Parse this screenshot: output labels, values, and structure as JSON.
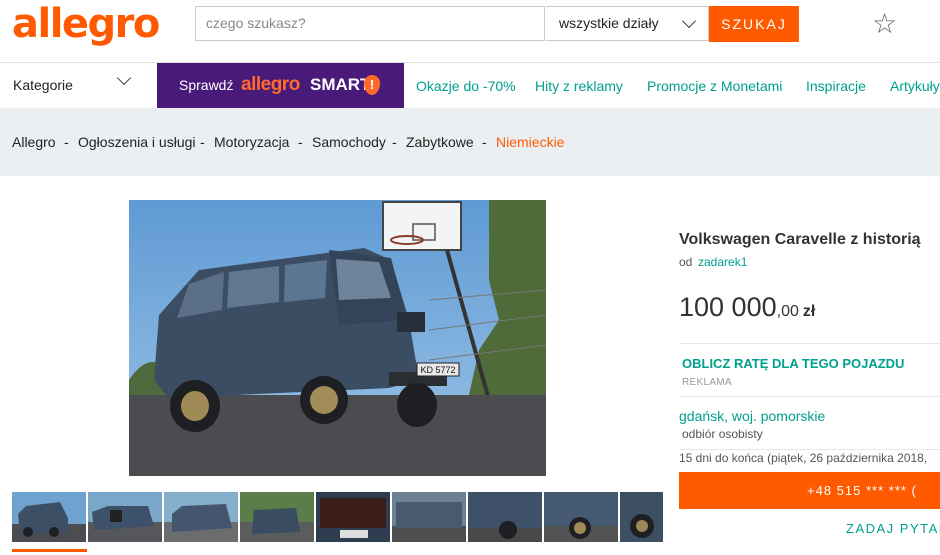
{
  "header": {
    "logo": "allegro",
    "search_placeholder": "czego szukasz?",
    "department": "wszystkie działy",
    "search_button": "SZUKAJ"
  },
  "nav": {
    "categories": "Kategorie",
    "smart_prefix": "Sprawdź",
    "smart_brand": "allegro",
    "smart_word": "SMART",
    "smart_badge": "!",
    "links": [
      "Okazje do -70%",
      "Hity z reklamy",
      "Promocje z Monetami",
      "Inspiracje",
      "Artykuły"
    ]
  },
  "breadcrumb": [
    "Allegro",
    "Ogłoszenia i usługi",
    "Motoryzacja",
    "Samochody",
    "Zabytkowe",
    "Niemieckie"
  ],
  "listing": {
    "title": "Volkswagen Caravelle z historią",
    "seller_prefix": "od",
    "seller": "zadarek1",
    "price_main": "100 000",
    "price_sep": ",",
    "price_cents": "00",
    "currency": "zł",
    "rate": "OBLICZ RATĘ DLA TEGO POJAZDU",
    "ad_label": "REKLAMA",
    "location": "gdańsk, woj. pomorskie",
    "pickup": "odbiór osobisty",
    "days_left": "15 dni do końca (piątek, 26 października 2018,",
    "phone": "+48 515 *** *** (",
    "ask": "ZADAJ PYTAN",
    "plate": "KD 5772"
  },
  "thumbs_count": 9,
  "colors": {
    "brand": "#ff5a00",
    "accent": "#00a08e",
    "smart_bg": "#4a1a7a"
  }
}
